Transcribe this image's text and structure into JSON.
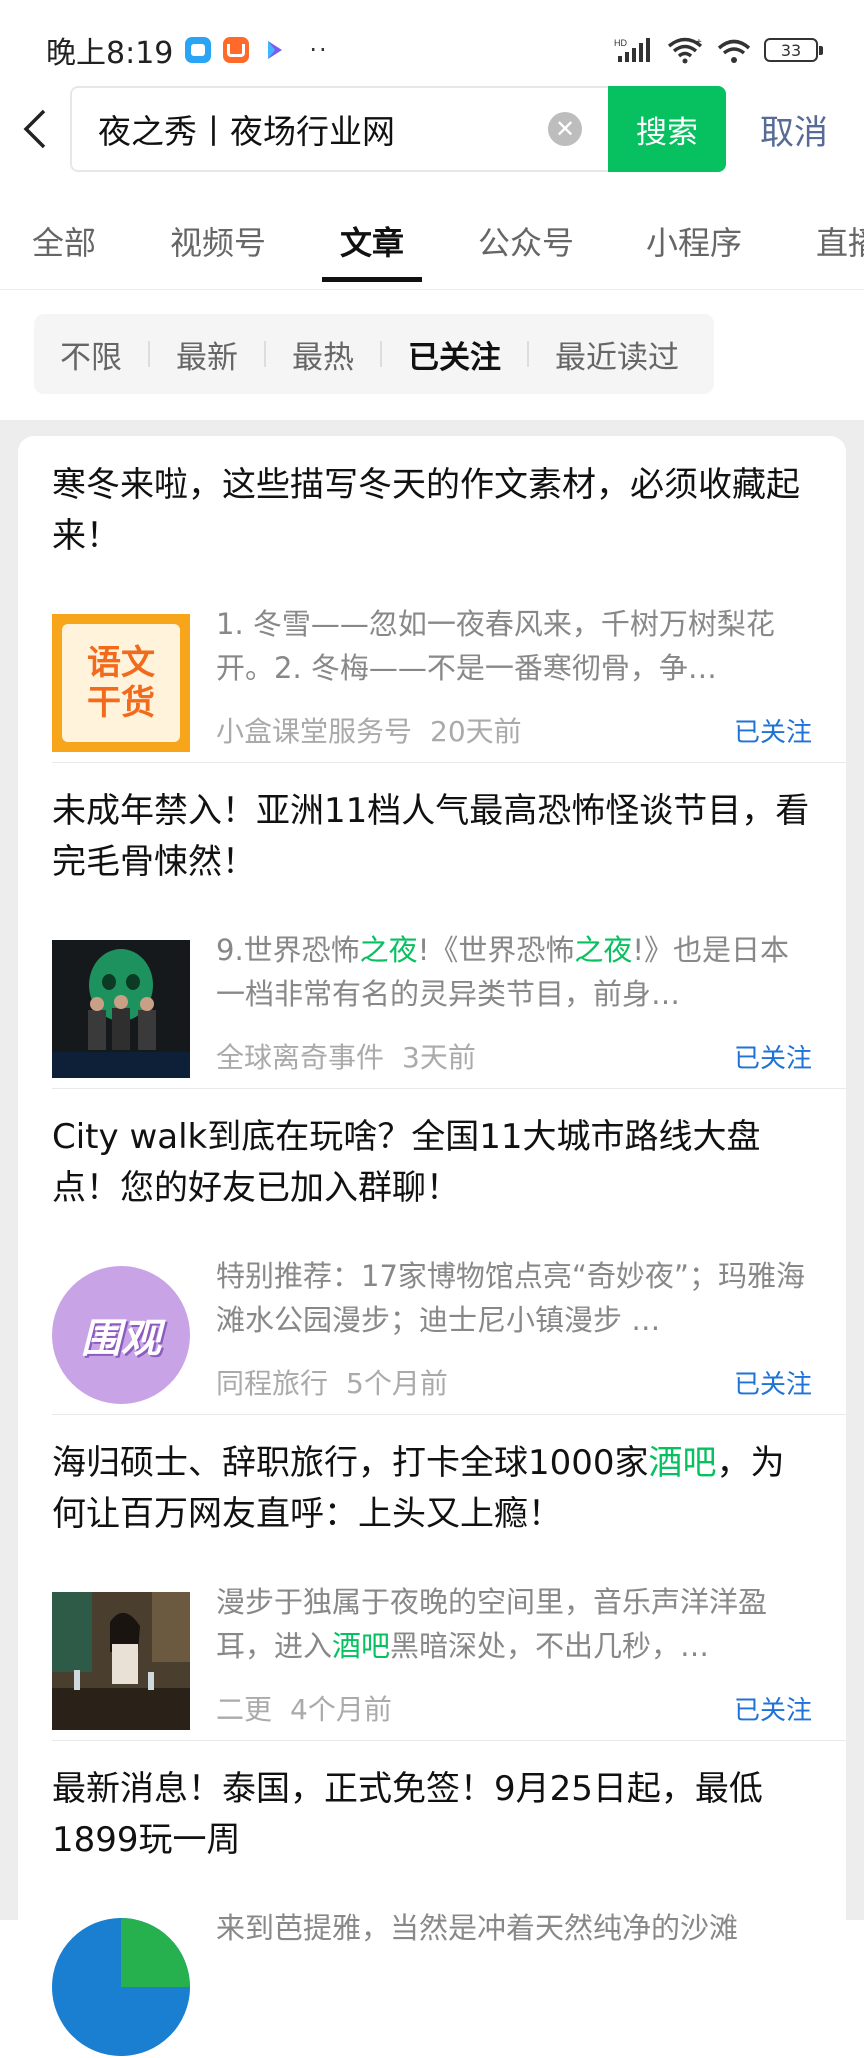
{
  "status_bar": {
    "time": "晚上8:19",
    "dots": "··",
    "battery": "33",
    "signal_label": "HD"
  },
  "search": {
    "query": "夜之秀丨夜场行业网",
    "search_button": "搜索",
    "cancel": "取消"
  },
  "tabs": [
    {
      "label": "全部"
    },
    {
      "label": "视频号"
    },
    {
      "label": "文章"
    },
    {
      "label": "公众号"
    },
    {
      "label": "小程序"
    },
    {
      "label": "直播"
    }
  ],
  "filters": [
    {
      "label": "不限"
    },
    {
      "label": "最新"
    },
    {
      "label": "最热"
    },
    {
      "label": "已关注"
    },
    {
      "label": "最近读过"
    }
  ],
  "articles": [
    {
      "title": "寒冬来啦，这些描写冬天的作文素材，必须收藏起来！",
      "snippet_parts": [
        "1. 冬雪——忽如一夜春风来，千树万树梨花开。2. 冬梅——不是一番寒彻骨，争…"
      ],
      "source": "小盒课堂服务号",
      "time": "20天前",
      "follow": "已关注",
      "thumb_text": [
        "语文",
        "干货"
      ]
    },
    {
      "title": "未成年禁入！亚洲11档人气最高恐怖怪谈节目，看完毛骨悚然！",
      "snippet_a": "9.世界恐怖",
      "snippet_hl1": "之夜",
      "snippet_b": "!《世界恐怖",
      "snippet_hl2": "之夜",
      "snippet_c": "!》也是日本一档非常有名的灵异类节目，前身…",
      "source": "全球离奇事件",
      "time": "3天前",
      "follow": "已关注"
    },
    {
      "title": "City walk到底在玩啥？全国11大城市路线大盘点！您的好友已加入群聊！",
      "snippet": "特别推荐：17家博物馆点亮“奇妙夜”；玛雅海滩水公园漫步；迪士尼小镇漫步 …",
      "source": "同程旅行",
      "time": "5个月前",
      "follow": "已关注",
      "thumb_text": "围观"
    },
    {
      "title_a": "海归硕士、辞职旅行，打卡全球1000家",
      "title_hl": "酒吧",
      "title_b": "，为何让百万网友直呼：上头又上瘾！",
      "snippet_a": "漫步于独属于夜晚的空间里，音乐声洋洋盈耳，进入",
      "snippet_hl": "酒吧",
      "snippet_b": "黑暗深处，不出几秒，…",
      "source": "二更",
      "time": "4个月前",
      "follow": "已关注"
    },
    {
      "title": "最新消息！泰国，正式免签！9月25日起，最低1899玩一周",
      "snippet": "来到芭提雅，当然是冲着天然纯净的沙滩"
    }
  ],
  "colors": {
    "accent_green": "#07c160",
    "link_blue": "#1f72d6",
    "cancel_blue": "#576b95"
  }
}
